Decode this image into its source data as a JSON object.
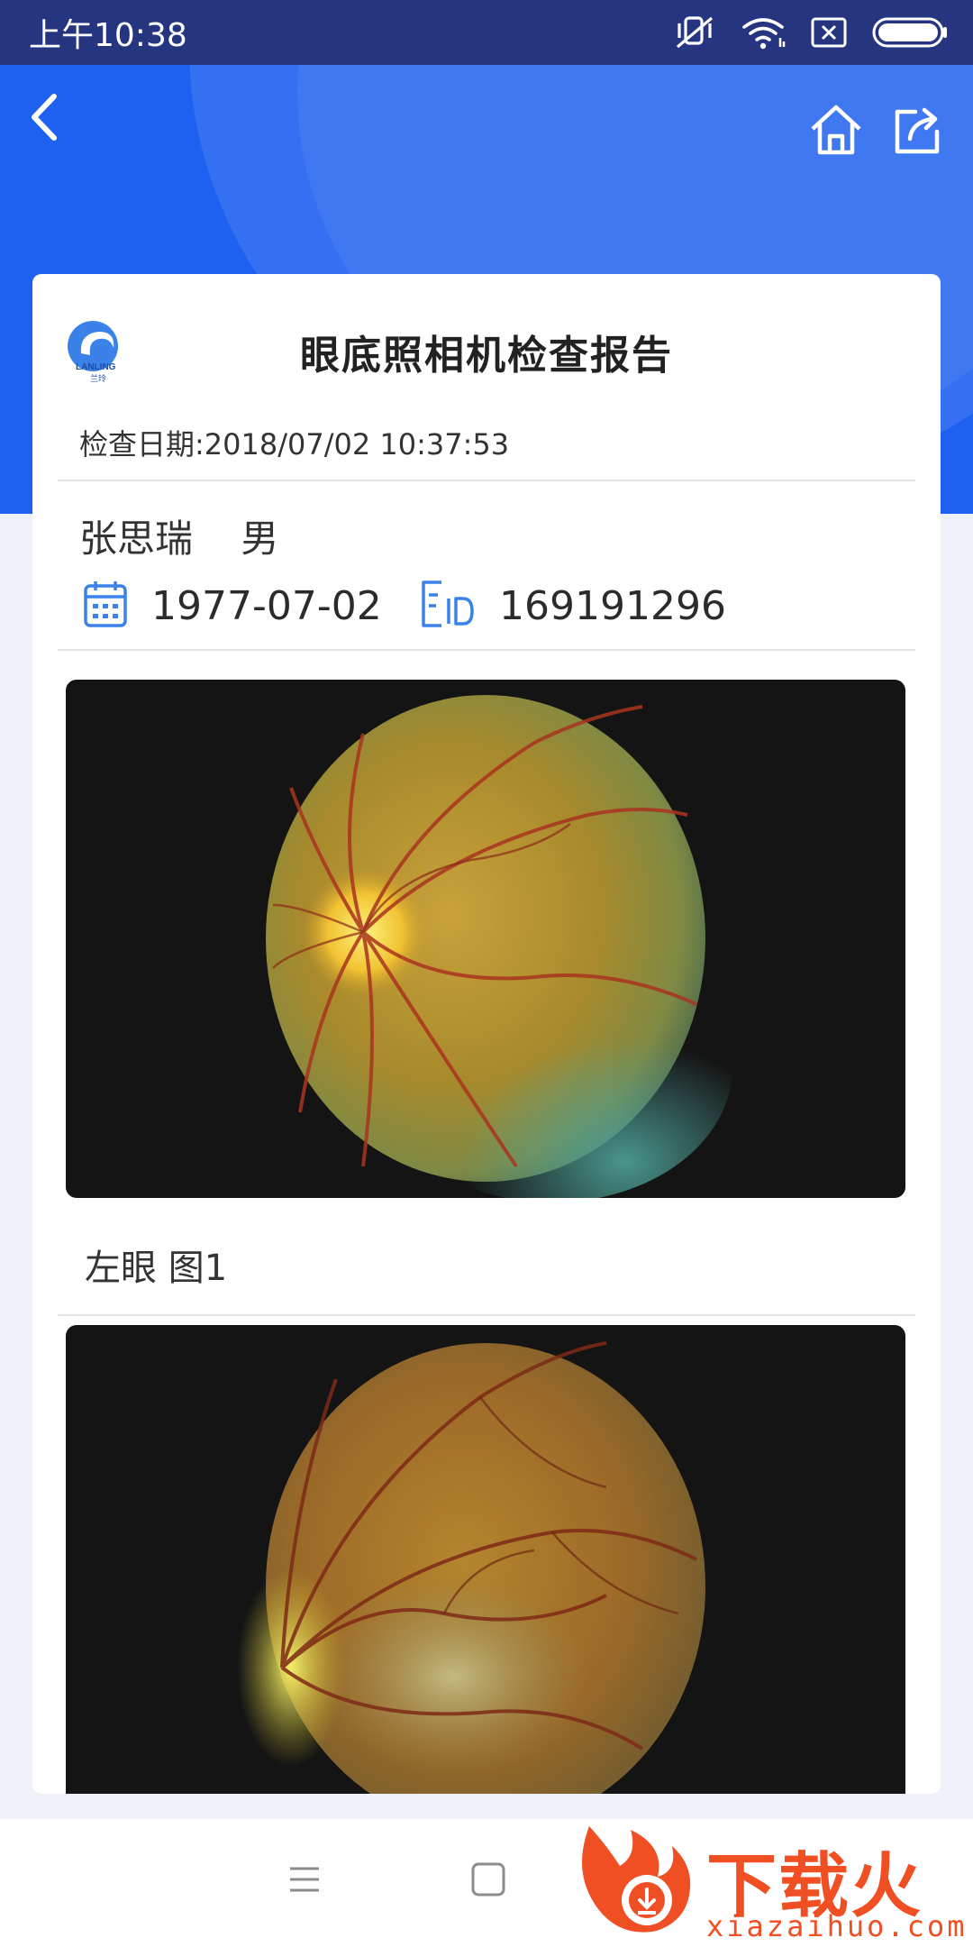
{
  "status_bar": {
    "time": "上午10:38",
    "icons": [
      "mute-icon",
      "wifi-icon",
      "sim-off-icon",
      "battery-icon"
    ]
  },
  "header": {
    "back_icon": "back-arrow-icon",
    "home_icon": "home-icon",
    "share_icon": "share-icon"
  },
  "report": {
    "logo_text": "LANLING",
    "logo_subtext": "兰玲",
    "title": "眼底照相机检查报告",
    "exam_date_label": "检查日期:",
    "exam_date_value": "2018/07/02 10:37:53"
  },
  "patient": {
    "name": "张思瑞",
    "gender": "男",
    "birth_date": "1977-07-02",
    "id_number": "169191296"
  },
  "images": [
    {
      "caption": "左眼 图1"
    }
  ],
  "bottom_nav": {
    "menu_icon": "menu-icon",
    "home_icon": "square-home-icon"
  },
  "watermark": {
    "text": "下载火",
    "subtext": "xiazaihuo.com"
  },
  "colors": {
    "status_bar": "#25357f",
    "header_blue": "#1e60f0",
    "accent_blue": "#3a82e8",
    "watermark_orange": "#f04e23"
  }
}
